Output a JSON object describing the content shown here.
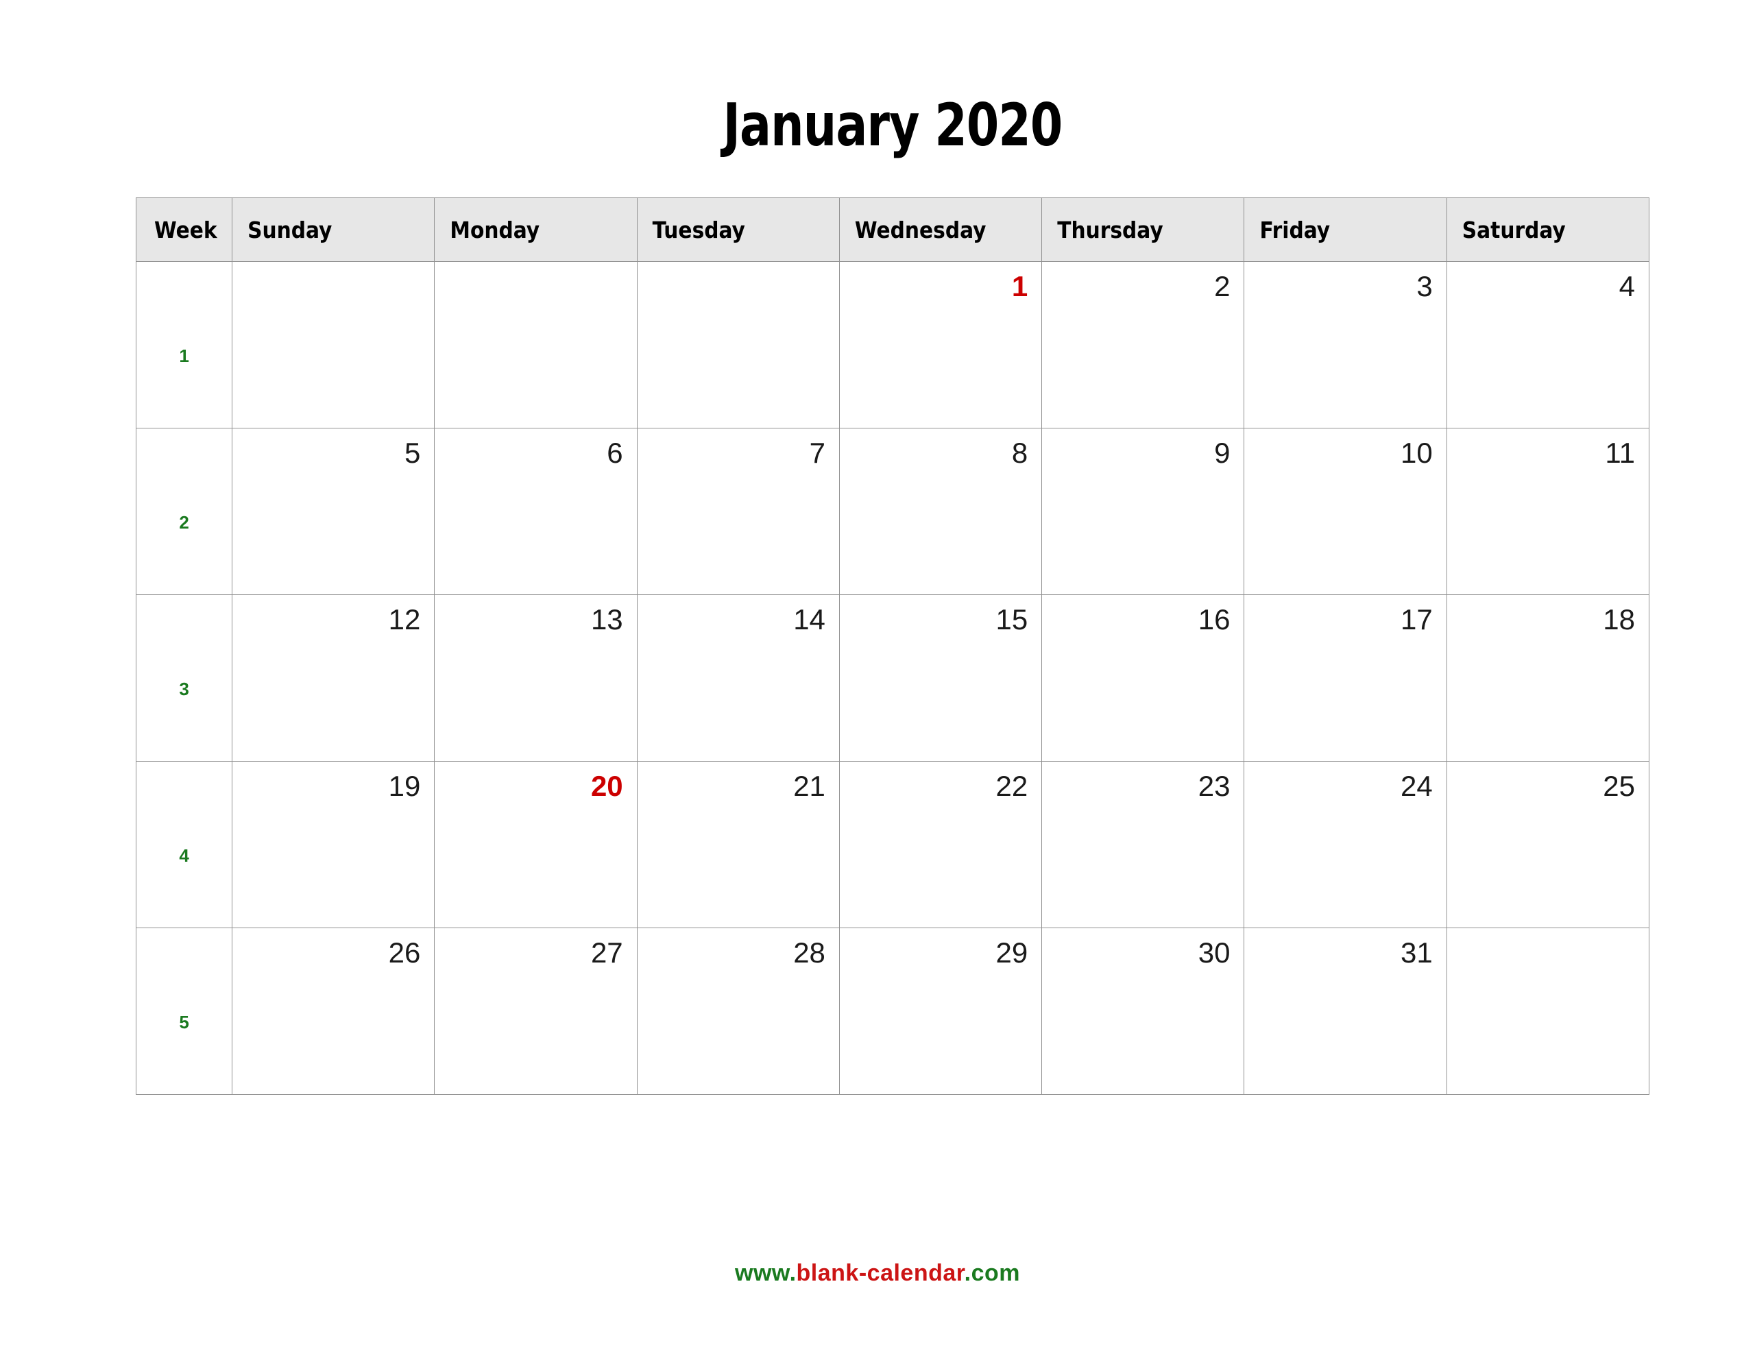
{
  "title": "January 2020",
  "table": {
    "headers": [
      {
        "key": "week",
        "label": "Week"
      },
      {
        "key": "sun",
        "label": "Sunday"
      },
      {
        "key": "mon",
        "label": "Monday"
      },
      {
        "key": "tue",
        "label": "Tuesday"
      },
      {
        "key": "wed",
        "label": "Wednesday"
      },
      {
        "key": "thu",
        "label": "Thursday"
      },
      {
        "key": "fri",
        "label": "Friday"
      },
      {
        "key": "sat",
        "label": "Saturday"
      }
    ],
    "weeks": [
      {
        "week_number": "1",
        "days": [
          {
            "value": "",
            "holiday": false
          },
          {
            "value": "",
            "holiday": false
          },
          {
            "value": "",
            "holiday": false
          },
          {
            "value": "1",
            "holiday": true
          },
          {
            "value": "2",
            "holiday": false
          },
          {
            "value": "3",
            "holiday": false
          },
          {
            "value": "4",
            "holiday": false
          }
        ]
      },
      {
        "week_number": "2",
        "days": [
          {
            "value": "5",
            "holiday": false
          },
          {
            "value": "6",
            "holiday": false
          },
          {
            "value": "7",
            "holiday": false
          },
          {
            "value": "8",
            "holiday": false
          },
          {
            "value": "9",
            "holiday": false
          },
          {
            "value": "10",
            "holiday": false
          },
          {
            "value": "11",
            "holiday": false
          }
        ]
      },
      {
        "week_number": "3",
        "days": [
          {
            "value": "12",
            "holiday": false
          },
          {
            "value": "13",
            "holiday": false
          },
          {
            "value": "14",
            "holiday": false
          },
          {
            "value": "15",
            "holiday": false
          },
          {
            "value": "16",
            "holiday": false
          },
          {
            "value": "17",
            "holiday": false
          },
          {
            "value": "18",
            "holiday": false
          }
        ]
      },
      {
        "week_number": "4",
        "days": [
          {
            "value": "19",
            "holiday": false
          },
          {
            "value": "20",
            "holiday": true
          },
          {
            "value": "21",
            "holiday": false
          },
          {
            "value": "22",
            "holiday": false
          },
          {
            "value": "23",
            "holiday": false
          },
          {
            "value": "24",
            "holiday": false
          },
          {
            "value": "25",
            "holiday": false
          }
        ]
      },
      {
        "week_number": "5",
        "days": [
          {
            "value": "26",
            "holiday": false
          },
          {
            "value": "27",
            "holiday": false
          },
          {
            "value": "28",
            "holiday": false
          },
          {
            "value": "29",
            "holiday": false
          },
          {
            "value": "30",
            "holiday": false
          },
          {
            "value": "31",
            "holiday": false
          },
          {
            "value": "",
            "holiday": false
          }
        ]
      }
    ]
  },
  "footer": {
    "prefix": "www.",
    "name": "blank-calendar",
    "suffix": ".com"
  },
  "colors": {
    "holiday": "#cc0000",
    "week_number": "#1a7a1f",
    "header_background": "#e7e7e7",
    "border": "#919191",
    "day_number": "#1a1a1a",
    "footer_green": "#1a7a1f",
    "footer_red": "#cc1414"
  }
}
